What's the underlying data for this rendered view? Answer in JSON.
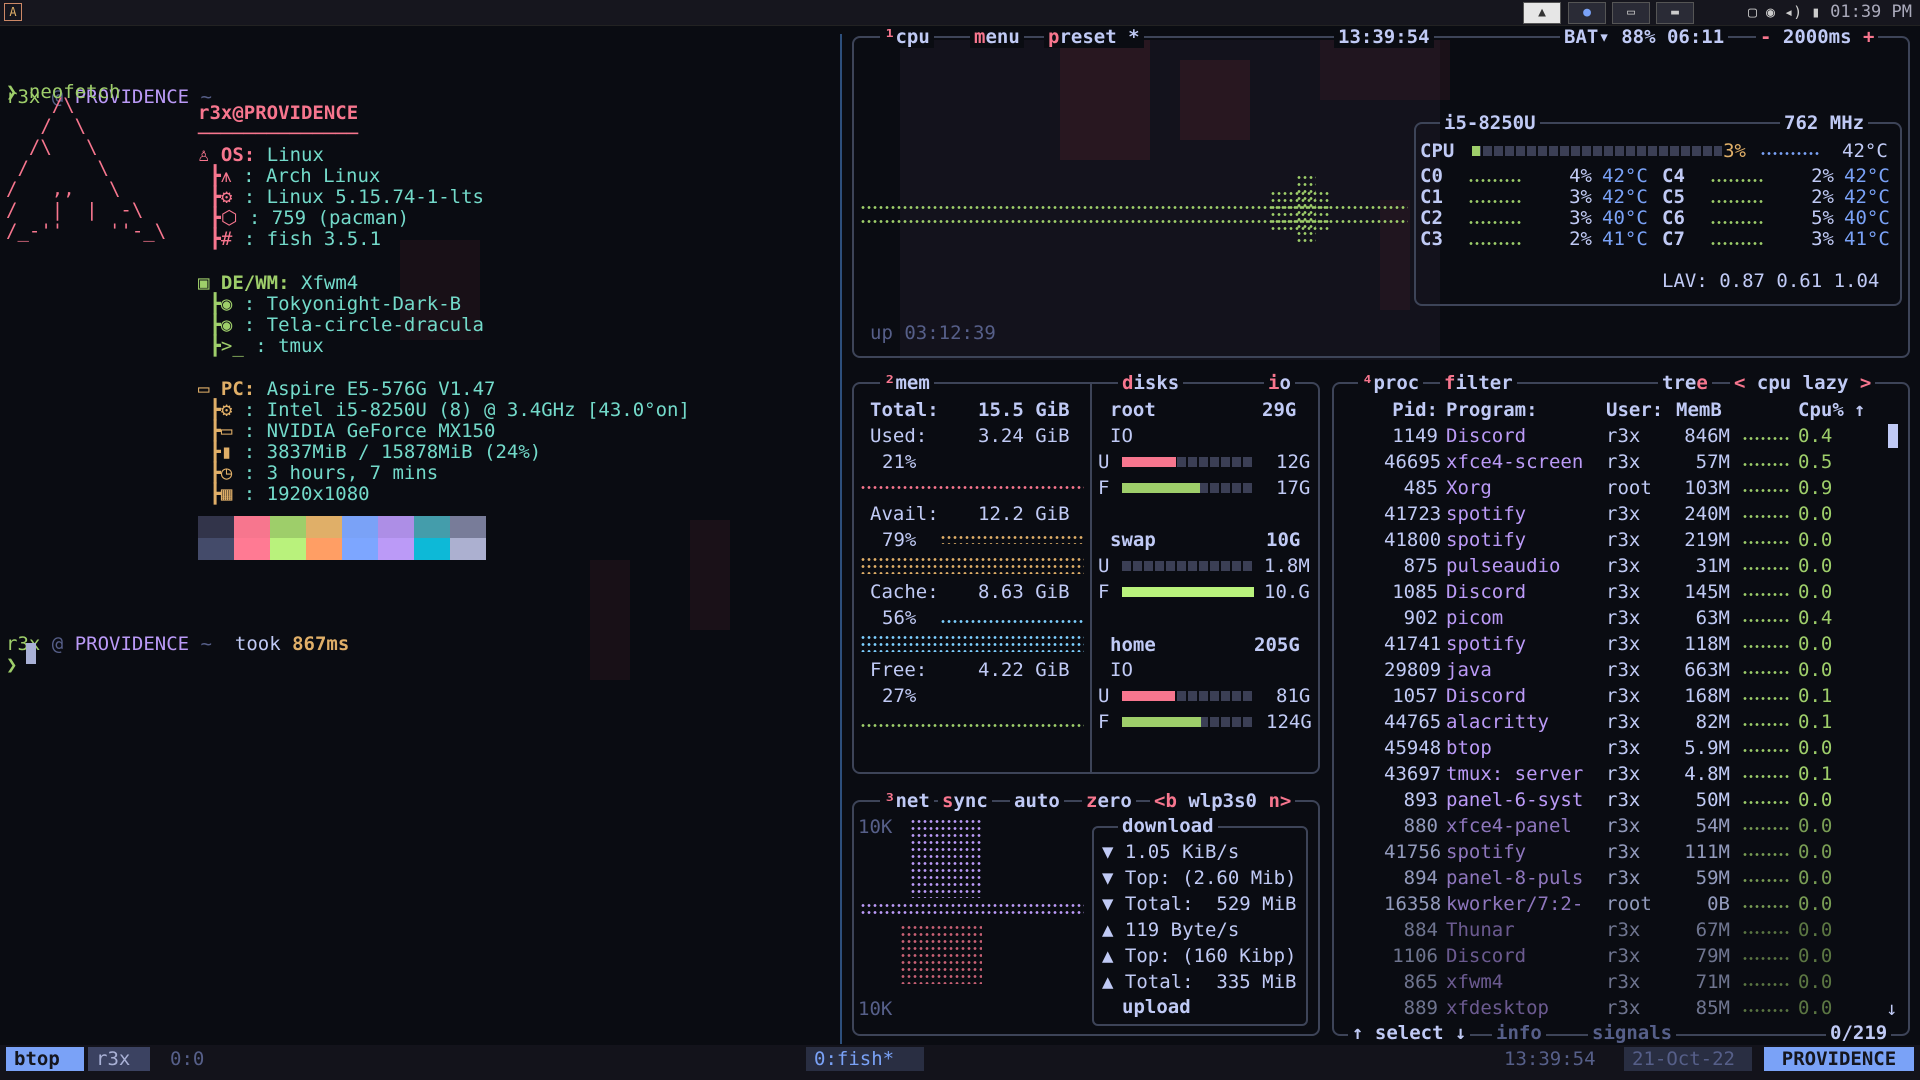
{
  "colors": {
    "accent": "#7aa2f7",
    "green": "#9ece6a",
    "purple": "#bb9af7",
    "red": "#f7768e",
    "orange": "#e0af68",
    "cyan": "#7dcfff",
    "bg": "#0a0c12"
  },
  "topbar": {
    "clock": "01:39 PM",
    "icons": [
      "arch-app-icon",
      "discord-icon",
      "files-icon",
      "window-icon"
    ]
  },
  "terminal": {
    "prompt1": {
      "user": "r3x",
      "at": "@",
      "host": "PROVIDENCE",
      "dir": "~"
    },
    "command": "neofetch",
    "logo": [
      "    /\\",
      "   /  \\",
      "  /\\   \\",
      " /      \\",
      "/   ,,   \\",
      "/   |  |  -\\",
      "/_-''    ''-_\\"
    ],
    "header": "r3x@PROVIDENCE",
    "underline": "──────────────",
    "os_label": "OS:",
    "os_value": "Linux",
    "os_lines": [
      ": Arch Linux",
      ": Linux 5.15.74-1-lts",
      ": 759 (pacman)",
      ": fish 3.5.1"
    ],
    "de_label": "DE/WM:",
    "de_value": "Xfwm4",
    "de_lines": [
      ": Tokyonight-Dark-B",
      ": Tela-circle-dracula",
      ": tmux"
    ],
    "pc_label": "PC:",
    "pc_value": "Aspire E5-576G V1.47",
    "pc_lines": [
      ": Intel i5-8250U (8) @ 3.4GHz [43.0°on]",
      ": NVIDIA GeForce MX150",
      ": 3837MiB / 15878MiB (24%)",
      ": 3 hours, 7 mins",
      ": 1920x1080"
    ],
    "palette_top": [
      "#32344a",
      "#f7768e",
      "#9ece6a",
      "#e0af68",
      "#7aa2f7",
      "#ad8ee6",
      "#449dab",
      "#787c99"
    ],
    "palette_bottom": [
      "#444b6a",
      "#ff7a93",
      "#b9f27c",
      "#ff9e64",
      "#7da6ff",
      "#bb9af7",
      "#0db9d7",
      "#acb0d0"
    ],
    "prompt2": {
      "user": "r3x",
      "at": "@",
      "host": "PROVIDENCE",
      "dir": "~",
      "took": "took",
      "time": "867ms"
    },
    "cursor_prompt": "❯"
  },
  "cpu": {
    "title_num": "¹",
    "title": "cpu",
    "menu": "menu",
    "preset": "preset *",
    "clock": "13:39:54",
    "battery": "BAT▾ 88% 06:11",
    "rate_minus": "-",
    "rate": "2000ms",
    "rate_plus": "+",
    "model": "i5-8250U",
    "freq": "762 MHz",
    "total": {
      "label": "CPU",
      "pct": "3%",
      "temp": "42°C",
      "level": 0.03
    },
    "cores": [
      {
        "label": "C0",
        "pct": "4%",
        "temp": "42°C"
      },
      {
        "label": "C1",
        "pct": "3%",
        "temp": "42°C"
      },
      {
        "label": "C2",
        "pct": "3%",
        "temp": "40°C"
      },
      {
        "label": "C3",
        "pct": "2%",
        "temp": "41°C"
      },
      {
        "label": "C4",
        "pct": "2%",
        "temp": "42°C"
      },
      {
        "label": "C5",
        "pct": "2%",
        "temp": "42°C"
      },
      {
        "label": "C6",
        "pct": "5%",
        "temp": "40°C"
      },
      {
        "label": "C7",
        "pct": "3%",
        "temp": "41°C"
      }
    ],
    "lav": "LAV: 0.87 0.61 1.04",
    "uptime": "up 03:12:39"
  },
  "mem": {
    "title_num": "²",
    "title": "mem",
    "total_label": "Total:",
    "total": "15.5 GiB",
    "used_label": "Used:",
    "used": "3.24 GiB",
    "used_pct": "21%",
    "avail_label": "Avail:",
    "avail": "12.2 GiB",
    "avail_pct": "79%",
    "cache_label": "Cache:",
    "cache": "8.63 GiB",
    "cache_pct": "56%",
    "free_label": "Free:",
    "free": "4.22 GiB",
    "free_pct": "27%"
  },
  "disks": {
    "title": "disks",
    "io": "io",
    "root": {
      "name": "root",
      "size": "29G",
      "io": "IO",
      "u_label": "U",
      "used": "12G",
      "u_level": 0.41,
      "f_label": "F",
      "free": "17G",
      "f_level": 0.59
    },
    "swap": {
      "name": "swap",
      "size": "10G",
      "u_label": "U",
      "used": "1.8M",
      "u_level": 0.0,
      "f_label": "F",
      "free": "10.G",
      "f_level": 1.0
    },
    "home": {
      "name": "home",
      "size": "205G",
      "io": "IO",
      "u_label": "U",
      "used": "81G",
      "u_level": 0.4,
      "f_label": "F",
      "free": "124G",
      "f_level": 0.6
    }
  },
  "net": {
    "title_num": "³",
    "title": "net",
    "sync": "sync",
    "auto": "auto",
    "zero": "zero",
    "prev": "<b",
    "iface": "wlp3s0",
    "next": "n>",
    "scale_top": "10K",
    "scale_bottom": "10K",
    "download_label": "download",
    "down_rows": [
      "▼ 1.05 KiB/s",
      "▼ Top: (2.60 Mib)",
      "▼ Total:  529 MiB"
    ],
    "up_rows": [
      "▲ 119 Byte/s",
      "▲ Top: (160 Kibp)",
      "▲ Total:  335 MiB"
    ],
    "upload_label": "upload"
  },
  "proc": {
    "title_num": "⁴",
    "title": "proc",
    "filter": "filter",
    "tree": "tree",
    "sort_prev": "<",
    "sort": "cpu lazy",
    "sort_next": ">",
    "headers": {
      "pid": "Pid:",
      "program": "Program:",
      "user": "User:",
      "mem": "MemB",
      "cpu": "Cpu%",
      "arrow": "↑"
    },
    "rows": [
      {
        "pid": "1149",
        "name": "Discord",
        "user": "r3x",
        "mem": "846M",
        "cpu": "0.4"
      },
      {
        "pid": "46695",
        "name": "xfce4-screen",
        "user": "r3x",
        "mem": "57M",
        "cpu": "0.5"
      },
      {
        "pid": "485",
        "name": "Xorg",
        "user": "root",
        "mem": "103M",
        "cpu": "0.9"
      },
      {
        "pid": "41723",
        "name": "spotify",
        "user": "r3x",
        "mem": "240M",
        "cpu": "0.0"
      },
      {
        "pid": "41800",
        "name": "spotify",
        "user": "r3x",
        "mem": "219M",
        "cpu": "0.0"
      },
      {
        "pid": "875",
        "name": "pulseaudio",
        "user": "r3x",
        "mem": "31M",
        "cpu": "0.0"
      },
      {
        "pid": "1085",
        "name": "Discord",
        "user": "r3x",
        "mem": "145M",
        "cpu": "0.0"
      },
      {
        "pid": "902",
        "name": "picom",
        "user": "r3x",
        "mem": "63M",
        "cpu": "0.4"
      },
      {
        "pid": "41741",
        "name": "spotify",
        "user": "r3x",
        "mem": "118M",
        "cpu": "0.0"
      },
      {
        "pid": "29809",
        "name": "java",
        "user": "r3x",
        "mem": "663M",
        "cpu": "0.0"
      },
      {
        "pid": "1057",
        "name": "Discord",
        "user": "r3x",
        "mem": "168M",
        "cpu": "0.1"
      },
      {
        "pid": "44765",
        "name": "alacritty",
        "user": "r3x",
        "mem": "82M",
        "cpu": "0.1"
      },
      {
        "pid": "45948",
        "name": "btop",
        "user": "r3x",
        "mem": "5.9M",
        "cpu": "0.0"
      },
      {
        "pid": "43697",
        "name": "tmux: server",
        "user": "r3x",
        "mem": "4.8M",
        "cpu": "0.1"
      },
      {
        "pid": "893",
        "name": "panel-6-syst",
        "user": "r3x",
        "mem": "50M",
        "cpu": "0.0"
      },
      {
        "pid": "880",
        "name": "xfce4-panel",
        "user": "r3x",
        "mem": "54M",
        "cpu": "0.0"
      },
      {
        "pid": "41756",
        "name": "spotify",
        "user": "r3x",
        "mem": "111M",
        "cpu": "0.0"
      },
      {
        "pid": "894",
        "name": "panel-8-puls",
        "user": "r3x",
        "mem": "59M",
        "cpu": "0.0"
      },
      {
        "pid": "16358",
        "name": "kworker/7:2-",
        "user": "root",
        "mem": "0B",
        "cpu": "0.0"
      },
      {
        "pid": "884",
        "name": "Thunar",
        "user": "r3x",
        "mem": "67M",
        "cpu": "0.0"
      },
      {
        "pid": "1106",
        "name": "Discord",
        "user": "r3x",
        "mem": "79M",
        "cpu": "0.0"
      },
      {
        "pid": "865",
        "name": "xfwm4",
        "user": "r3x",
        "mem": "71M",
        "cpu": "0.0"
      },
      {
        "pid": "889",
        "name": "xfdesktop",
        "user": "r3x",
        "mem": "85M",
        "cpu": "0.0"
      }
    ],
    "footer": {
      "select": "↑ select ↓",
      "info": "info",
      "signals": "signals",
      "count": "0/219"
    }
  },
  "statusbar": {
    "session": "btop",
    "user": "r3x",
    "pane": "0:0",
    "window": "0:fish*",
    "time": "13:39:54",
    "date": "21-Oct-22",
    "host": "PROVIDENCE"
  }
}
